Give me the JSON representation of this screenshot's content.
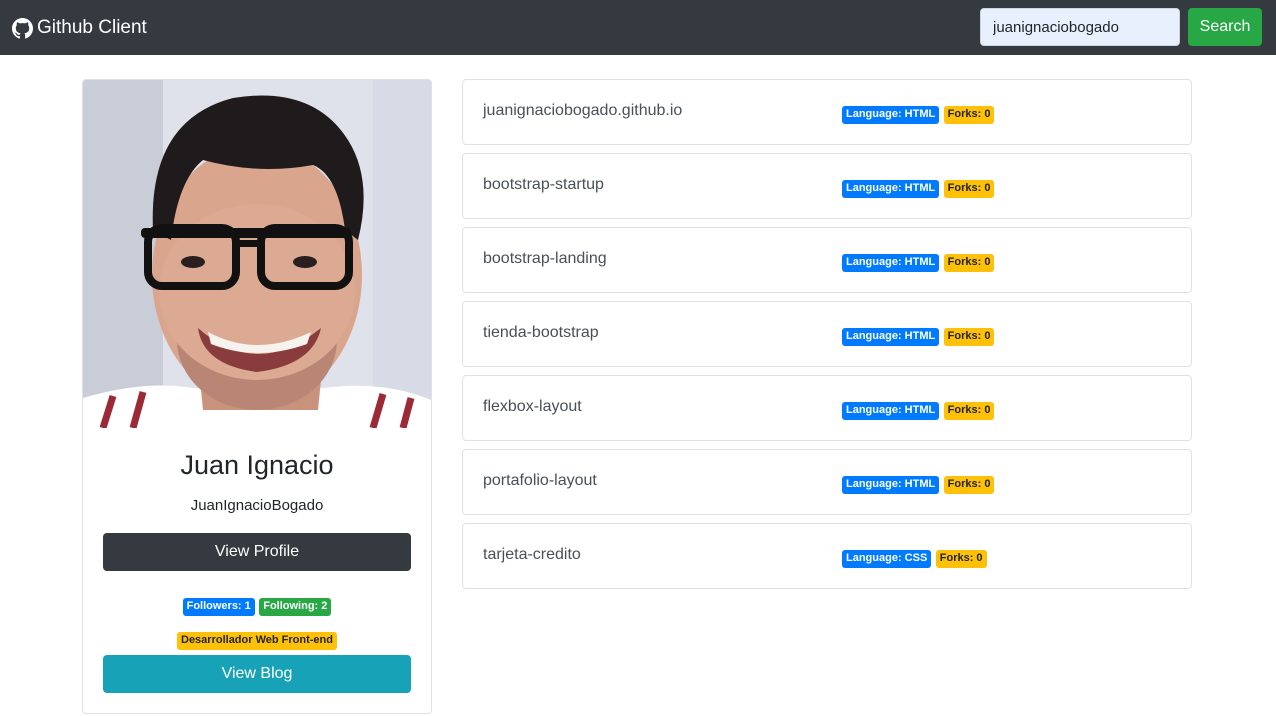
{
  "navbar": {
    "brand": "Github Client",
    "search_value": "juanignaciobogado",
    "search_button": "Search"
  },
  "profile": {
    "name": "Juan Ignacio",
    "login": "JuanIgnacioBogado",
    "view_profile": "View Profile",
    "followers": "Followers: 1",
    "following": "Following: 2",
    "bio": "Desarrollador Web Front-end",
    "view_blog": "View Blog"
  },
  "repos": [
    {
      "name": "juanignaciobogado.github.io",
      "language": "Language: HTML",
      "forks": "Forks: 0"
    },
    {
      "name": "bootstrap-startup",
      "language": "Language: HTML",
      "forks": "Forks: 0"
    },
    {
      "name": "bootstrap-landing",
      "language": "Language: HTML",
      "forks": "Forks: 0"
    },
    {
      "name": "tienda-bootstrap",
      "language": "Language: HTML",
      "forks": "Forks: 0"
    },
    {
      "name": "flexbox-layout",
      "language": "Language: HTML",
      "forks": "Forks: 0"
    },
    {
      "name": "portafolio-layout",
      "language": "Language: HTML",
      "forks": "Forks: 0"
    },
    {
      "name": "tarjeta-credito",
      "language": "Language: CSS",
      "forks": "Forks: 0"
    }
  ],
  "colors": {
    "navbar": "#343a40",
    "success": "#28a745",
    "primary": "#007bff",
    "info": "#17a2b8",
    "warning": "#ffc107"
  }
}
